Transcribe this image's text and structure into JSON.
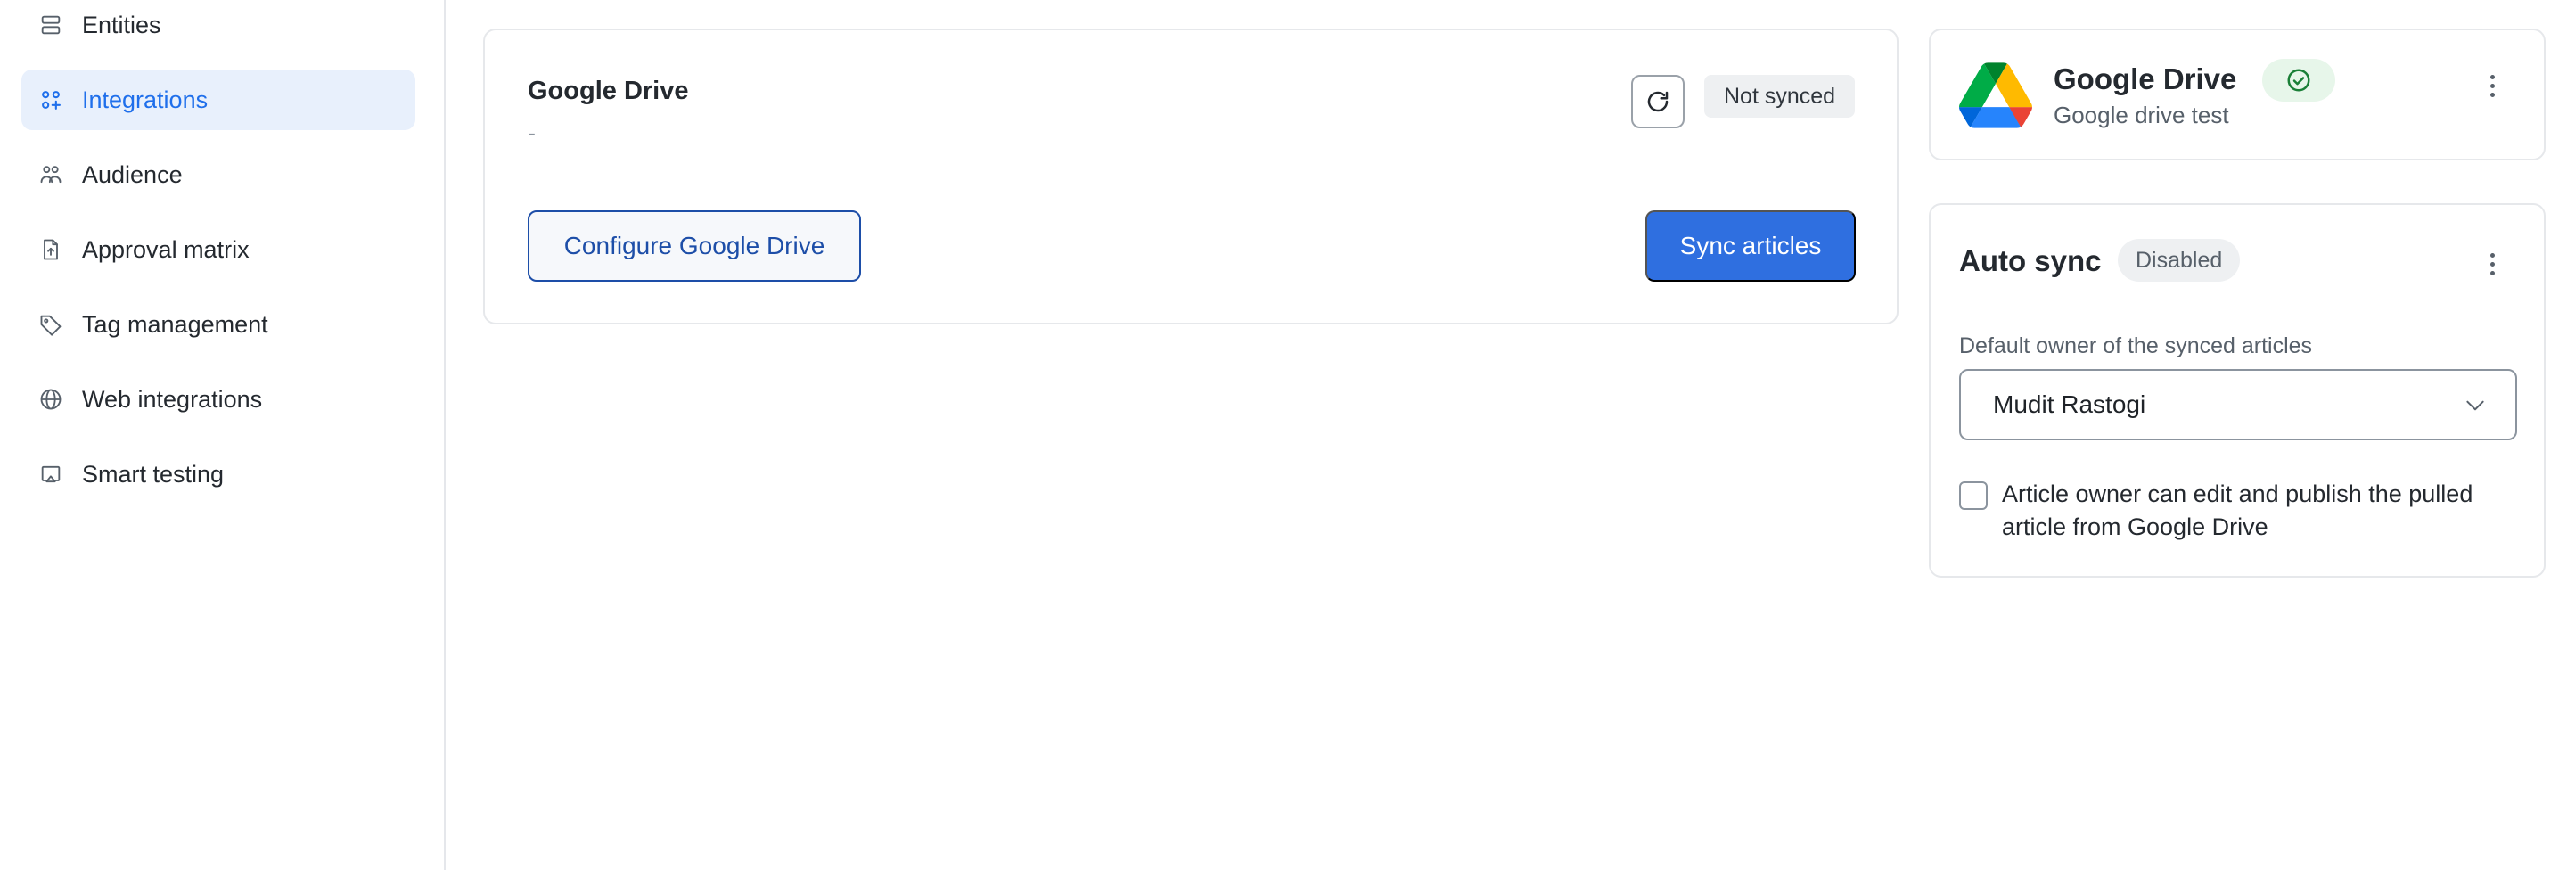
{
  "sidebar": {
    "items": [
      {
        "label": "Entities",
        "icon": "stack-icon",
        "active": false
      },
      {
        "label": "Integrations",
        "icon": "grid-plus-icon",
        "active": true
      },
      {
        "label": "Audience",
        "icon": "users-icon",
        "active": false
      },
      {
        "label": "Approval matrix",
        "icon": "file-upload-icon",
        "active": false
      },
      {
        "label": "Tag management",
        "icon": "tag-icon",
        "active": false
      },
      {
        "label": "Web integrations",
        "icon": "globe-icon",
        "active": false
      },
      {
        "label": "Smart testing",
        "icon": "screen-cast-icon",
        "active": false
      }
    ]
  },
  "main_card": {
    "title": "Google Drive",
    "subtitle": "-",
    "status": "Not synced",
    "configure_label": "Configure Google Drive",
    "sync_label": "Sync articles"
  },
  "drive_card": {
    "title": "Google Drive",
    "subtitle": "Google drive test",
    "connected_icon": "check-circle-icon"
  },
  "auto_sync": {
    "title": "Auto sync",
    "status": "Disabled",
    "owner_label": "Default owner of the synced articles",
    "owner_value": "Mudit Rastogi",
    "checkbox_label": "Article owner can edit and publish the pulled article from Google Drive",
    "checkbox_checked": false
  },
  "colors": {
    "accent": "#2f6fe0",
    "active_nav_bg": "#e8f0fc",
    "success_bg": "#e7f6ea",
    "success": "#1a7f37"
  }
}
